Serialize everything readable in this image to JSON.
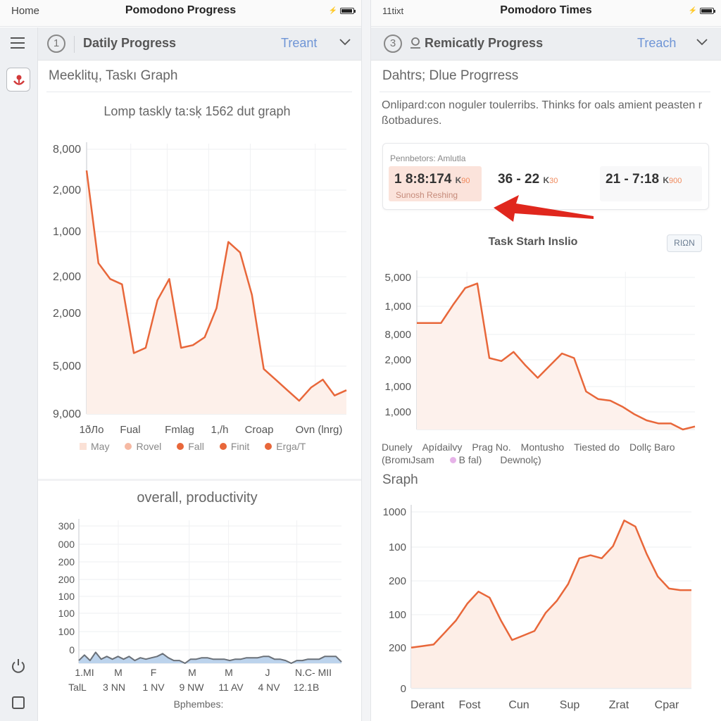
{
  "left_screen": {
    "status": {
      "left": "Home",
      "title": "Pomodono Progress"
    },
    "toolbar": {
      "number": "1",
      "title": "Datily Progress",
      "link": "Treant"
    },
    "sidebar": {
      "items": [
        "menu",
        "app-badge",
        "power",
        "window"
      ]
    },
    "section_heading": "Meeklitų, Taskı Graph",
    "chart1": {
      "title": "Lomp taskly ta:sķ 1562 dut graph",
      "yticks": [
        "8,000",
        "2,000",
        "1,000",
        "2,000",
        "2,000",
        "5,000",
        "9,000"
      ],
      "xticks": [
        "1ðЛo",
        "Fual",
        "Fmlag",
        "1,/h",
        "Croap",
        "Ovn (lnrg)"
      ],
      "legend": [
        {
          "label": "May",
          "shape": "square",
          "color": "#fbe1d6"
        },
        {
          "label": "Rovel",
          "shape": "dot",
          "color": "#f6b9a3"
        },
        {
          "label": "Fall",
          "shape": "dot",
          "color": "#e8673a"
        },
        {
          "label": "Finit",
          "shape": "dot",
          "color": "#e8673a"
        },
        {
          "label": "Erga/T",
          "shape": "dot",
          "color": "#e8673a"
        }
      ]
    },
    "chart2": {
      "title": "overall, productivity",
      "yticks": [
        "300",
        "000",
        "200",
        "200",
        "100",
        "100",
        "100",
        "0"
      ],
      "xticks_row1": [
        "1.MI",
        "M",
        "F",
        "M",
        "M",
        "J",
        "N.C- MII"
      ],
      "xticks_row2": [
        "TalL",
        "3 NN",
        "1 NV",
        "9 NW",
        "11 AV",
        "4 NV",
        "12.1B"
      ],
      "xlabel": "Bphembes:"
    }
  },
  "right_screen": {
    "status": {
      "left": "11tixt",
      "title": "Pomodoro Times"
    },
    "toolbar": {
      "number": "3",
      "title": "Remicatly Progress",
      "link": "Treach"
    },
    "section_heading": "Dahtrs; Dlue Progrress",
    "description": "Onlipard:con noguler toulerribs. Thinks for oals amient peasten r ßotbadures.",
    "stats": {
      "label": "Pennbetors: Amlutla",
      "items": [
        {
          "value": "1 8:8:174",
          "unit": "K",
          "suffix": "90",
          "sub": "Sunosh Reshing",
          "highlight": true
        },
        {
          "value": "36 - 22",
          "unit": "K",
          "suffix": "30",
          "sub": "",
          "highlight": false
        },
        {
          "value": "21 - 7:18",
          "unit": "K",
          "suffix": "900",
          "sub": "",
          "highlight": false
        }
      ]
    },
    "chart3": {
      "title": "Task Starh Inslio",
      "button": "RIΩN",
      "yticks": [
        "5,000",
        "1,000",
        "8,000",
        "2,000",
        "1,000",
        "1,000"
      ],
      "categories_row1": [
        "Dunely",
        "Apídailvy",
        "Prag No.",
        "Montusho",
        "Tiested do",
        "Dollç Baro"
      ],
      "categories_row2": [
        "(BromιJsam",
        "B fal)",
        "Dewnolç)"
      ],
      "legend_dot_color": "#e6b3e8"
    },
    "section2_heading": "Sraph",
    "chart4": {
      "yticks": [
        "1000",
        "100",
        "200",
        "100",
        "200",
        "0"
      ],
      "xticks": [
        "Derant",
        "Fost",
        "Cun",
        "Sup",
        "Zrat",
        "Cpar"
      ]
    }
  },
  "colors": {
    "accent": "#e8673a",
    "fill": "#fdeee7",
    "link": "#6f95d6",
    "area_blue": "#bcd3ec",
    "line_gray": "#6a7078",
    "arrow": "#e0271d"
  },
  "chart_data": [
    {
      "type": "area",
      "title": "Lomp taskly ta:sķ 1562 dut graph",
      "xlabel": "",
      "ylabel": "",
      "ylim": [
        0,
        100
      ],
      "ytick_labels": [
        "8,000",
        "2,000",
        "1,000",
        "2,000",
        "2,000",
        "5,000",
        "9,000"
      ],
      "xtick_labels": [
        "1ðЛo",
        "Fual",
        "Fmlag",
        "1,/h",
        "Croap",
        "Ovn (lnrg)"
      ],
      "x": [
        0,
        1,
        2,
        3,
        4,
        5,
        6,
        7,
        8,
        9,
        10,
        11,
        12,
        13,
        14,
        15,
        16,
        17,
        18,
        19,
        20,
        21,
        22
      ],
      "values": [
        92,
        57,
        51,
        49,
        23,
        25,
        43,
        51,
        25,
        26,
        29,
        40,
        65,
        61,
        45,
        17,
        13,
        9,
        5,
        10,
        13,
        7,
        9
      ],
      "grid": true,
      "legend": "bottom"
    },
    {
      "type": "area",
      "title": "overall, productivity",
      "xlabel": "Bphembes:",
      "ylim": [
        0,
        100
      ],
      "ytick_labels": [
        "300",
        "000",
        "200",
        "200",
        "100",
        "100",
        "100",
        "0"
      ],
      "values": [
        2,
        6,
        2,
        8,
        3,
        5,
        3,
        5,
        3,
        5,
        2,
        4,
        3,
        4,
        5,
        7,
        4,
        2,
        2,
        0,
        3,
        3,
        4,
        4,
        3,
        3,
        3,
        2,
        3,
        3,
        4,
        4,
        4,
        5,
        5,
        3,
        3,
        2,
        0,
        2,
        2,
        3,
        3,
        3,
        5,
        5,
        5,
        1
      ],
      "grid": true
    },
    {
      "type": "area",
      "title": "Task Starh Inslio",
      "ylim": [
        0,
        100
      ],
      "ytick_labels": [
        "5,000",
        "1,000",
        "8,000",
        "2,000",
        "1,000",
        "1,000"
      ],
      "values": [
        70,
        70,
        70,
        82,
        93,
        96,
        47,
        45,
        51,
        42,
        34,
        42,
        50,
        47,
        25,
        20,
        19,
        15,
        10,
        6,
        4,
        4,
        0,
        2
      ],
      "grid": true
    },
    {
      "type": "area",
      "title": "Sraph",
      "ylim": [
        0,
        100
      ],
      "ytick_labels": [
        "1000",
        "100",
        "200",
        "100",
        "200",
        "0"
      ],
      "xtick_labels": [
        "Derant",
        "Fost",
        "Cun",
        "Sup",
        "Zrat",
        "Cpar"
      ],
      "values": [
        15,
        16,
        17,
        25,
        33,
        44,
        52,
        48,
        33,
        20,
        23,
        26,
        38,
        46,
        57,
        74,
        76,
        74,
        82,
        99,
        95,
        77,
        62,
        54,
        53,
        53
      ],
      "grid": true
    }
  ]
}
